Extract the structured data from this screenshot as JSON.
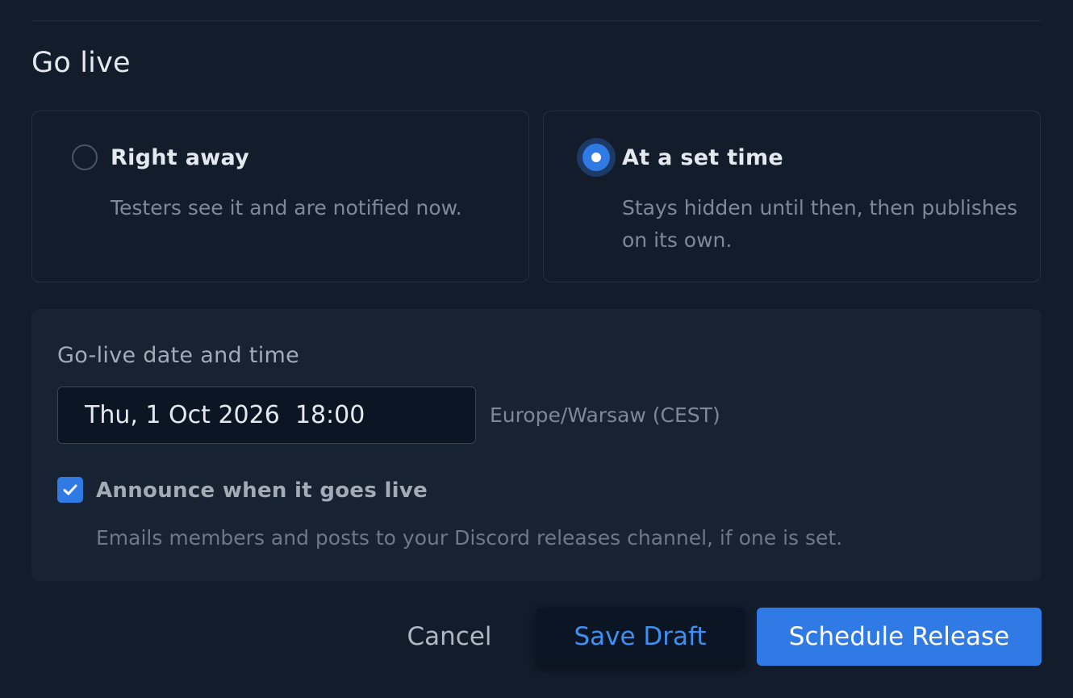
{
  "section": {
    "title": "Go live"
  },
  "options": [
    {
      "title": "Right away",
      "description": "Testers see it and are notified now.",
      "selected": false
    },
    {
      "title": "At a set time",
      "description": "Stays hidden until then, then publishes on its own.",
      "selected": true
    }
  ],
  "schedule": {
    "label": "Go-live date and time",
    "datetime_value": "Thu, 1 Oct 2026  18:00",
    "timezone": "Europe/Warsaw (CEST)",
    "announce": {
      "label": "Announce when it goes live",
      "description": "Emails members and posts to your Discord releases channel, if one is set.",
      "checked": true
    }
  },
  "actions": {
    "cancel_label": "Cancel",
    "save_draft_label": "Save Draft",
    "schedule_label": "Schedule Release"
  },
  "colors": {
    "accent": "#2f7ae5",
    "background": "#131c2b",
    "panel": "#172232"
  },
  "icons": {
    "checkbox": "check-icon"
  }
}
